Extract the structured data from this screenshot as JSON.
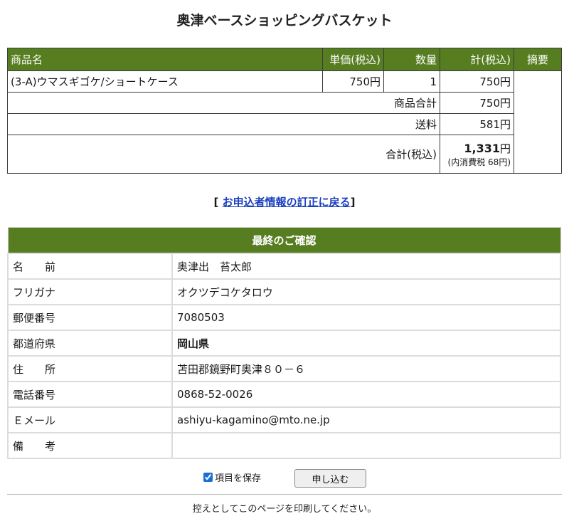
{
  "title": "奥津ベースショッピングバスケット",
  "basket": {
    "headers": {
      "name": "商品名",
      "unit_price": "単価(税込)",
      "qty": "数量",
      "subtotal": "計(税込)",
      "memo": "摘要"
    },
    "items": [
      {
        "name": "(3-A)ウマスギゴケ/ショートケース",
        "unit_price": "750円",
        "qty": "1",
        "subtotal": "750円"
      }
    ],
    "goods_total_label": "商品合計",
    "goods_total_value": "750円",
    "shipping_label": "送料",
    "shipping_value": "581円",
    "grand_total_label": "合計(税込)",
    "grand_total_number": "1,331",
    "grand_total_unit": "円",
    "tax_note": "(内消費税 68円)"
  },
  "back_link": {
    "open_bracket": "[",
    "label": "お申込者情報の訂正に戻る",
    "close_bracket": "]"
  },
  "confirm": {
    "heading": "最終のご確認",
    "rows": [
      {
        "label": "名　　前",
        "value": "奥津出　苔太郎"
      },
      {
        "label": "フリガナ",
        "value": "オクツデコケタロウ"
      },
      {
        "label": "郵便番号",
        "value": "7080503"
      },
      {
        "label": "都道府県",
        "value": "岡山県"
      },
      {
        "label": "住　　所",
        "value": "苫田郡鏡野町奥津８０－６"
      },
      {
        "label": "電話番号",
        "value": "0868-52-0026"
      },
      {
        "label": "Ｅメール",
        "value": "ashiyu-kagamino@mto.ne.jp"
      },
      {
        "label": "備　　考",
        "value": ""
      }
    ]
  },
  "save_items_label": "項目を保存",
  "save_items_checked": true,
  "submit_label": "申し込む",
  "footer_text": "控えとしてこのページを印刷してください。",
  "colors": {
    "header_green": "#577d21",
    "link_blue": "#1a3fbf"
  }
}
